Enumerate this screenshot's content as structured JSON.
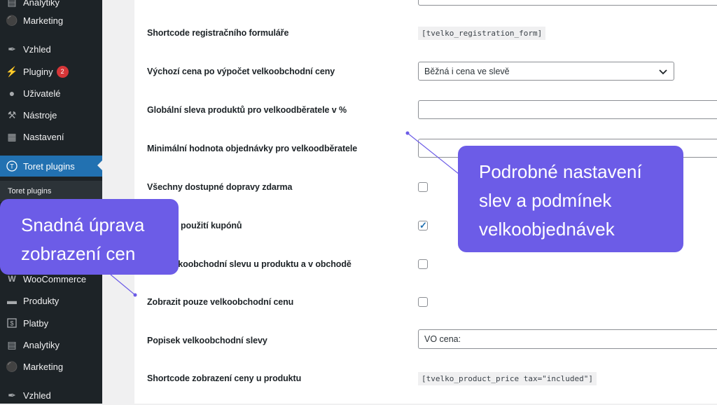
{
  "sidebar": {
    "items": [
      {
        "label": "Analytiky",
        "icon": "bar-chart-icon"
      },
      {
        "label": "Marketing",
        "icon": "megaphone-icon"
      },
      {
        "label": "Vzhled",
        "icon": "paintbrush-icon"
      },
      {
        "label": "Pluginy",
        "icon": "plug-icon",
        "badge": "2"
      },
      {
        "label": "Uživatelé",
        "icon": "user-icon"
      },
      {
        "label": "Nástroje",
        "icon": "wrench-icon"
      },
      {
        "label": "Nastavení",
        "icon": "settings-icon"
      },
      {
        "label": "Toret plugins",
        "icon": "toret-icon",
        "active": true
      },
      {
        "label": "WooCommerce",
        "icon": "woocommerce-icon"
      },
      {
        "label": "Produkty",
        "icon": "archive-icon"
      },
      {
        "label": "Platby",
        "icon": "payment-icon"
      },
      {
        "label": "Analytiky",
        "icon": "bar-chart-icon"
      },
      {
        "label": "Marketing",
        "icon": "megaphone-icon"
      },
      {
        "label": "Vzhled",
        "icon": "paintbrush-icon"
      }
    ],
    "submenu_label": "Toret plugins"
  },
  "settings": {
    "rows": [
      {
        "label": "Shortcode registračního formuláře",
        "code": "[tvelko_registration_form]"
      },
      {
        "label": "Výchozí cena po výpočet velkoobchodní ceny",
        "select_value": "Běžná i cena ve slevě"
      },
      {
        "label": "Globální sleva produktů pro velkoodběratele v %",
        "input_value": ""
      },
      {
        "label": "Minimální hodnota objednávky pro velkoodběratele",
        "input_value": ""
      },
      {
        "label": "Všechny dostupné dopravy zdarma",
        "checked": false
      },
      {
        "label": "použití kupónů",
        "checked": true
      },
      {
        "label": "elkoobchodní slevu u produktu a v obchodě",
        "checked": false
      },
      {
        "label": "Zobrazit pouze velkoobchodní cenu",
        "checked": false
      },
      {
        "label": "Popisek velkoobchodní slevy",
        "input_value": "VO cena:"
      },
      {
        "label": "Shortcode zobrazení ceny u produktu",
        "code": "[tvelko_product_price tax=\"included\"]"
      }
    ]
  },
  "callouts": {
    "left": {
      "line1": "Snadná úprava",
      "line2": "zobrazení cen"
    },
    "right": {
      "line1": "Podrobné nastavení",
      "line2": "slev a podmínek",
      "line3": "velkoobjednávek"
    }
  },
  "colors": {
    "sidebar_bg": "#1d2327",
    "accent": "#2271b1",
    "callout": "#6c5ce7",
    "badge": "#d63638"
  }
}
